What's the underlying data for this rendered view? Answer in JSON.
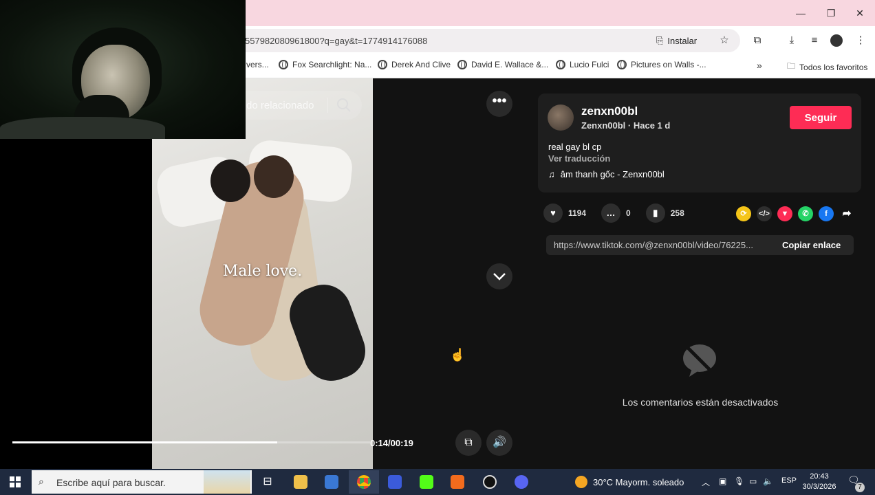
{
  "browser": {
    "url": "557982080961800?q=gay&t=1774914176088",
    "install_label": "Instalar",
    "bookmarks": [
      "vers...",
      "Fox Searchlight: Na...",
      "Derek And Clive",
      "David E. Wallace &...",
      "Lucio Fulci",
      "Pictures on Walls -..."
    ],
    "all_bookmarks": "Todos los favoritos"
  },
  "video": {
    "search_text": "do relacionado",
    "caption": "Male love.",
    "time": "0:14/00:19",
    "progress": 0.74
  },
  "post": {
    "username": "zenxn00bl",
    "meta": "Zenxn00bl · Hace 1 d",
    "follow": "Seguir",
    "description": "real gay bl cp",
    "translate": "Ver traducción",
    "music": "âm thanh gốc - Zenxn00bl",
    "likes": "1194",
    "comments": "0",
    "saves": "258",
    "link": "https://www.tiktok.com/@zenxn00bl/video/76225...",
    "copy": "Copiar enlace",
    "comments_off": "Los comentarios están desactivados"
  },
  "taskbar": {
    "search_placeholder": "Escribe aquí para buscar.",
    "weather": "30°C  Mayorm. soleado",
    "lang": "ESP",
    "time": "20:43",
    "date": "30/3/2026",
    "notifications": "7"
  },
  "colors": {
    "follow": "#fe2c55",
    "titlebar": "#f8d7e0",
    "taskbar": "#1f2a3f"
  }
}
